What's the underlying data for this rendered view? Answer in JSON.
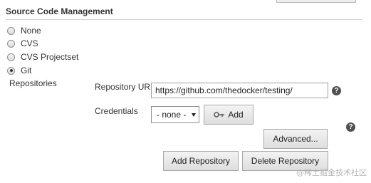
{
  "section": {
    "title": "Source Code Management"
  },
  "scm_options": [
    {
      "label": "None",
      "selected": false
    },
    {
      "label": "CVS",
      "selected": false
    },
    {
      "label": "CVS Projectset",
      "selected": false
    },
    {
      "label": "Git",
      "selected": true
    }
  ],
  "repositories": {
    "label": "Repositories",
    "url_label": "Repository URL",
    "url_value": "https://github.com/thedocker/testing/",
    "credentials_label": "Credentials",
    "credentials_selected": "- none -",
    "add_label": "Add",
    "advanced_label": "Advanced...",
    "add_repository_label": "Add Repository",
    "delete_repository_label": "Delete Repository"
  },
  "help_glyph": "?",
  "icons": {
    "help": "help-icon",
    "key": "key-icon"
  },
  "watermark": "@稀土掘金技术社区"
}
